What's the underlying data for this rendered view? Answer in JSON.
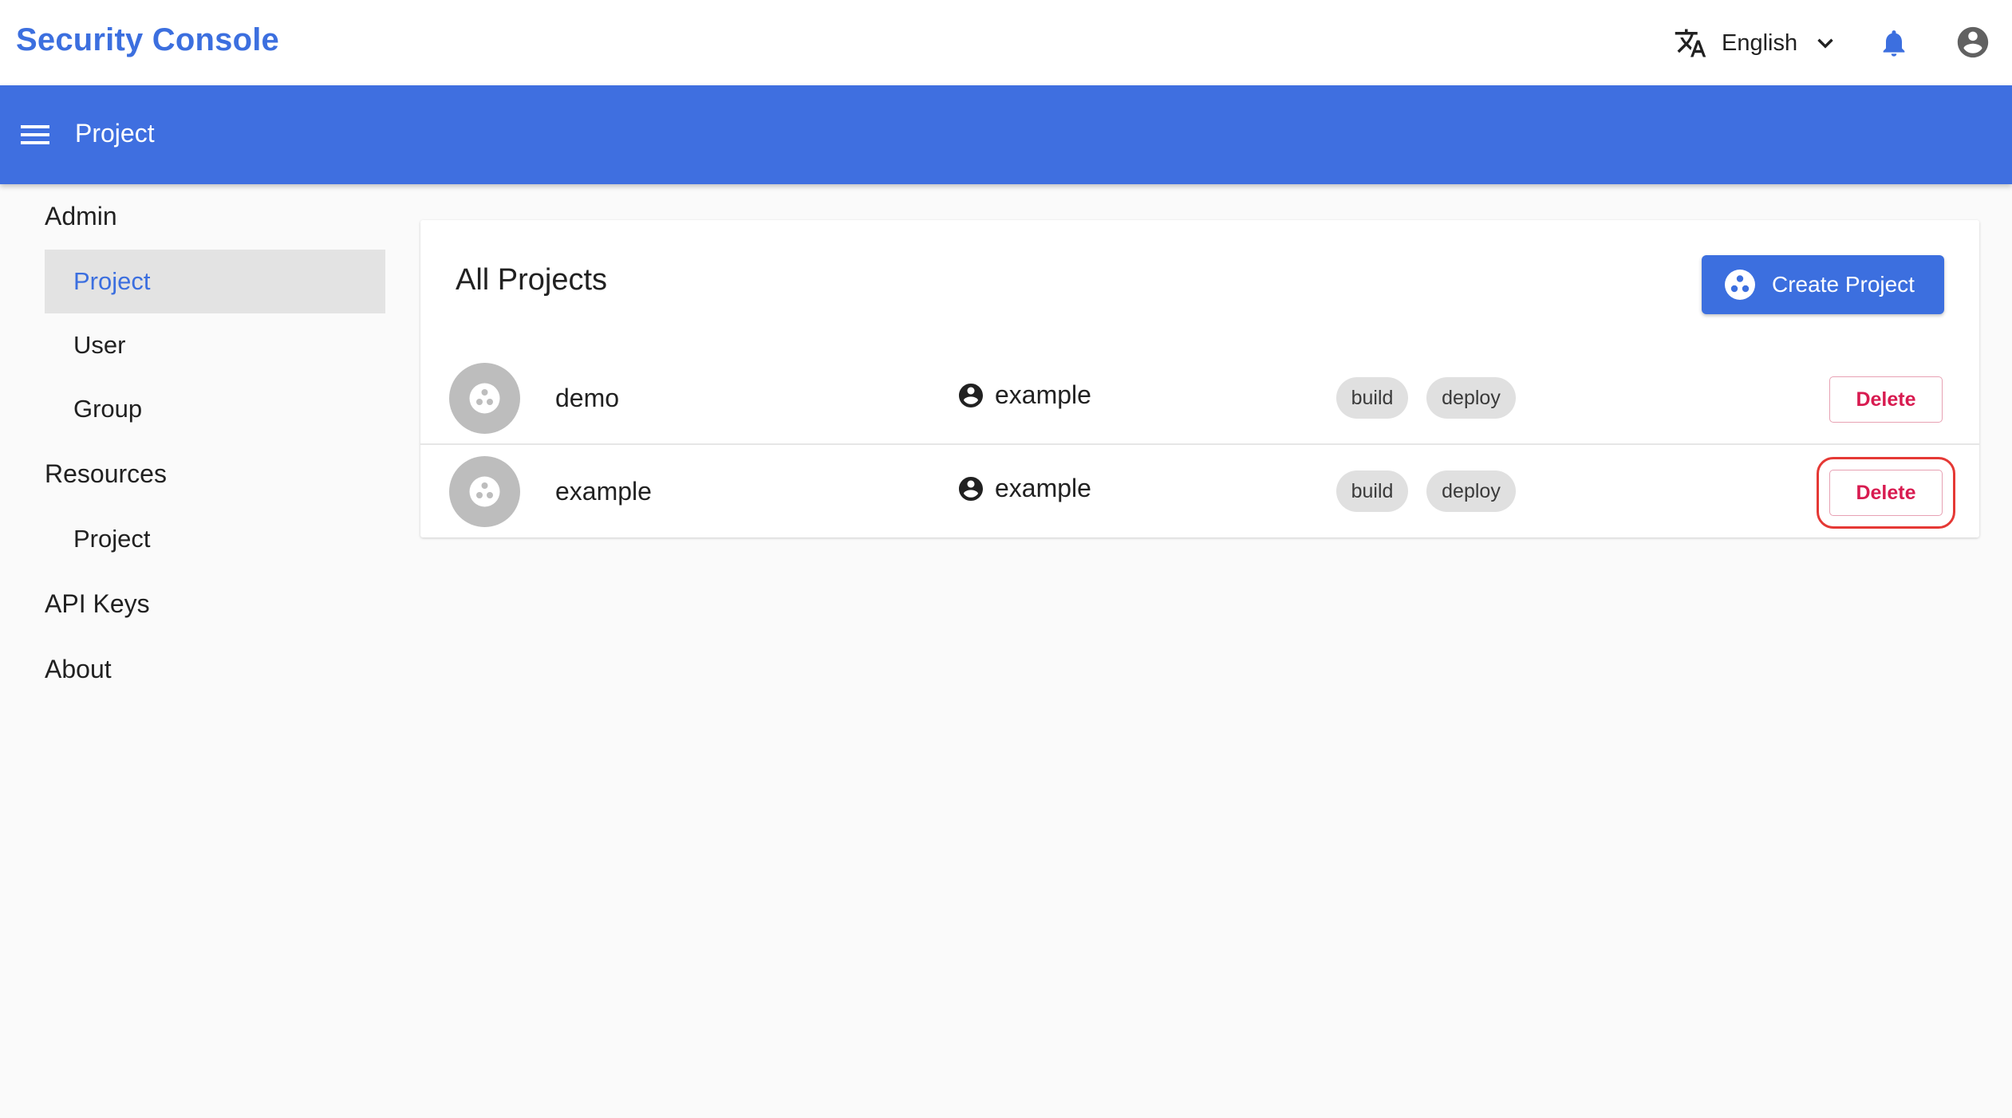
{
  "app": {
    "title": "Security Console"
  },
  "header": {
    "language": "English",
    "icons": [
      "translate-icon",
      "chevron-down-icon",
      "bell-icon",
      "account-circle-icon"
    ]
  },
  "toolbar": {
    "title": "Project"
  },
  "sidebar": {
    "sections": [
      {
        "label": "Admin",
        "items": [
          {
            "label": "Project",
            "active": true
          },
          {
            "label": "User"
          },
          {
            "label": "Group"
          }
        ]
      },
      {
        "label": "Resources",
        "items": [
          {
            "label": "Project"
          }
        ]
      },
      {
        "label": "API Keys",
        "items": []
      },
      {
        "label": "About",
        "items": []
      }
    ]
  },
  "main": {
    "title": "All Projects",
    "create_label": "Create Project",
    "projects": [
      {
        "name": "demo",
        "owner": "example",
        "tags": [
          "build",
          "deploy"
        ],
        "delete_label": "Delete"
      },
      {
        "name": "example",
        "owner": "example",
        "tags": [
          "build",
          "deploy"
        ],
        "delete_label": "Delete",
        "highlighted": true
      }
    ]
  },
  "colors": {
    "brand": "#3c6fdf",
    "toolbar": "#3f6fe0",
    "danger": "#d81b50",
    "highlight": "#e53935"
  }
}
